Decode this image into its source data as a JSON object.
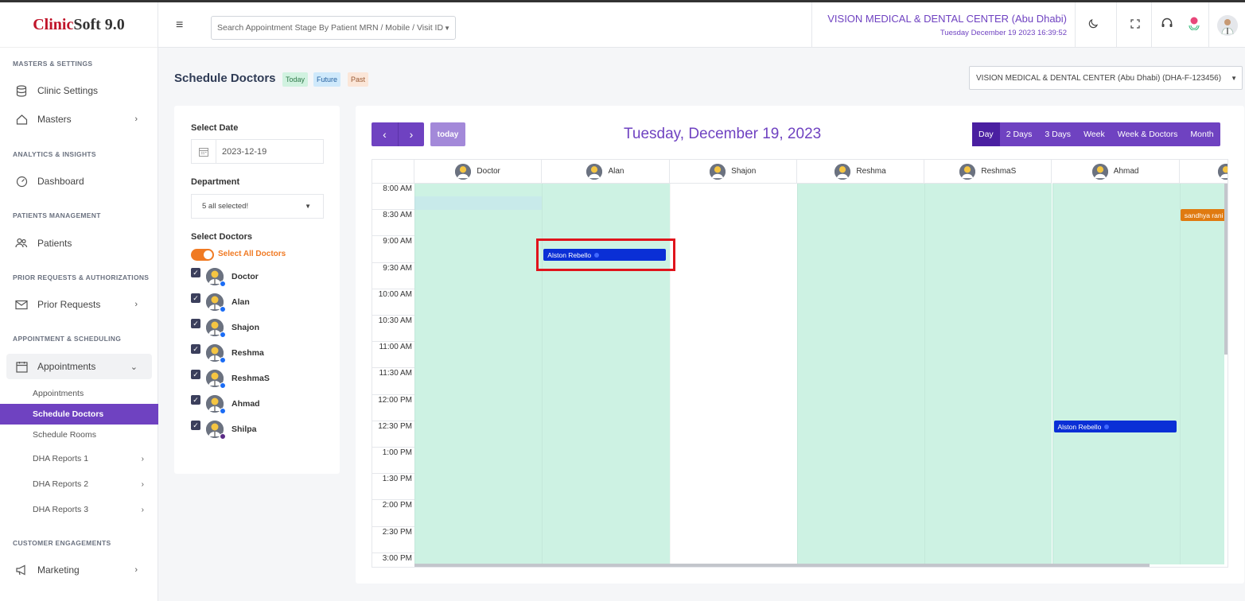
{
  "app": {
    "logo_a": "Clinic",
    "logo_b": "Soft 9.0"
  },
  "header": {
    "search_placeholder": "Search Appointment Stage By Patient MRN / Mobile / Visit ID",
    "clinic_name": "VISION MEDICAL & DENTAL CENTER (Abu Dhabi)",
    "datetime": "Tuesday December 19 2023 16:39:52"
  },
  "sidebar": {
    "sections": [
      "MASTERS & SETTINGS",
      "ANALYTICS & INSIGHTS",
      "PATIENTS MANAGEMENT",
      "PRIOR REQUESTS & AUTHORIZATIONS",
      "APPOINTMENT & SCHEDULING",
      "CUSTOMER ENGAGEMENTS"
    ],
    "items": [
      "Clinic Settings",
      "Masters",
      "Dashboard",
      "Patients",
      "Prior Requests",
      "Appointments",
      "Marketing"
    ],
    "subitems": [
      "Appointments",
      "Schedule Doctors",
      "Schedule Rooms",
      "DHA Reports 1",
      "DHA Reports 2",
      "DHA Reports 3"
    ]
  },
  "page": {
    "title": "Schedule Doctors",
    "tags": [
      "Today",
      "Future",
      "Past"
    ],
    "clinic_select": "VISION MEDICAL & DENTAL CENTER (Abu Dhabi) (DHA-F-123456)"
  },
  "filters": {
    "select_date_label": "Select Date",
    "date_value": "2023-12-19",
    "department_label": "Department",
    "department_value": "5 all selected!",
    "select_doctors_label": "Select Doctors",
    "select_all_label": "Select All Doctors",
    "doctors": [
      "Doctor",
      "Alan",
      "Shajon",
      "Reshma",
      "ReshmaS",
      "Ahmad",
      "Shilpa"
    ]
  },
  "calendar": {
    "today_label": "today",
    "title": "Tuesday, December 19, 2023",
    "views": [
      "Day",
      "2 Days",
      "3 Days",
      "Week",
      "Week & Doctors",
      "Month"
    ],
    "active_view": "Day",
    "columns": [
      "Doctor",
      "Alan",
      "Shajon",
      "Reshma",
      "ReshmaS",
      "Ahmad"
    ],
    "times": [
      "8:00 AM",
      "8:30 AM",
      "9:00 AM",
      "9:30 AM",
      "10:00 AM",
      "10:30 AM",
      "11:00 AM",
      "11:30 AM",
      "12:00 PM",
      "12:30 PM",
      "1:00 PM",
      "1:30 PM",
      "2:00 PM",
      "2:30 PM",
      "3:00 PM"
    ],
    "events": [
      {
        "label": "Alston Rebello",
        "column": "Alan",
        "time": "9:15 AM"
      },
      {
        "label": "Alston Rebello",
        "column": "Ahmad",
        "time": "12:30 PM"
      },
      {
        "label": "sandhya rani",
        "column": "Shilpa",
        "time": "8:30 AM"
      }
    ]
  },
  "colors": {
    "accent": "#6f42c1",
    "available": "#cdf2e3",
    "event": "#0a2fd6",
    "event_alt": "#e07a10",
    "highlight": "#e0141c"
  }
}
